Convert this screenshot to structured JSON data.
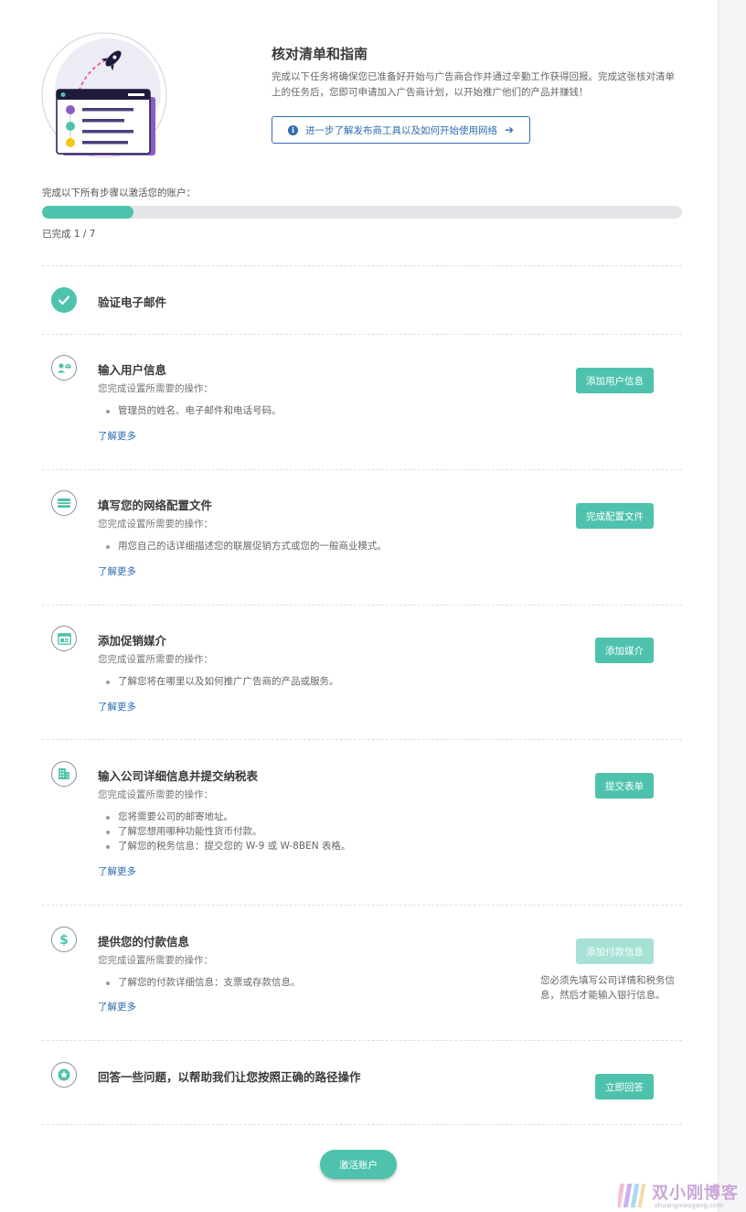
{
  "header": {
    "title": "核对清单和指南",
    "description": "完成以下任务将确保您已准备好开始与广告商合作并通过辛勤工作获得回报。完成这张核对清单上的任务后，您即可申请加入广告商计划，以开始推广他们的产品并赚钱！",
    "learn_link": "进一步了解发布商工具以及如何开始使用网络"
  },
  "progress": {
    "label": "完成以下所有步骤以激活您的账户：",
    "count_text": "已完成 1 / 7",
    "completed": 1,
    "total": 7,
    "fill_fraction": 0.143
  },
  "steps": [
    {
      "title": "验证电子邮件",
      "icon": "check-icon",
      "done": true
    },
    {
      "title": "输入用户信息",
      "sub": "您完成设置所需要的操作：",
      "bullets": [
        "管理员的姓名、电子邮件和电话号码。"
      ],
      "learn": "了解更多",
      "button": "添加用户信息",
      "icon": "user-card-icon"
    },
    {
      "title": "填写您的网络配置文件",
      "sub": "您完成设置所需要的操作：",
      "bullets": [
        "用您自己的话详细描述您的联展促销方式或您的一般商业模式。"
      ],
      "learn": "了解更多",
      "button": "完成配置文件",
      "icon": "profile-card-icon"
    },
    {
      "title": "添加促销媒介",
      "sub": "您完成设置所需要的操作：",
      "bullets": [
        "了解您将在哪里以及如何推广广告商的产品或服务。"
      ],
      "learn": "了解更多",
      "button": "添加媒介",
      "icon": "browser-window-icon"
    },
    {
      "title": "输入公司详细信息并提交纳税表",
      "sub": "您完成设置所需要的操作：",
      "bullets": [
        "您将需要公司的邮寄地址。",
        "了解您想用哪种功能性货币付款。",
        "了解您的税务信息：提交您的 W-9 或 W-8BEN 表格。"
      ],
      "learn": "了解更多",
      "button": "提交表单",
      "icon": "building-icon"
    },
    {
      "title": "提供您的付款信息",
      "sub": "您完成设置所需要的操作：",
      "bullets": [
        "了解您的付款详细信息：支票或存款信息。"
      ],
      "learn": "了解更多",
      "button": "添加付款信息",
      "button_disabled": true,
      "note": "您必须先填写公司详情和税务信息，然后才能输入银行信息。",
      "icon": "dollar-icon"
    },
    {
      "title": "回答一些问题，以帮助我们让您按照正确的路径操作",
      "button": "立即回答",
      "icon": "star-icon"
    }
  ],
  "activate_button": "激活账户",
  "watermark": {
    "text": "双小刚博客",
    "sub": "shuangxiaogang.com"
  },
  "colors": {
    "accent": "#4ec2ad",
    "link": "#2f6db0",
    "illus_purple": "#8b5cc4",
    "illus_navy": "#1e1a3c"
  }
}
